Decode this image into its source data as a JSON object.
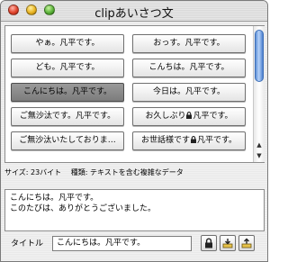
{
  "window": {
    "title": "clipあいさつ文"
  },
  "clips": [
    {
      "label": "やぁ。凡平です。",
      "locked": false,
      "selected": false
    },
    {
      "label": "おっす。凡平です。",
      "locked": false,
      "selected": false
    },
    {
      "label": "ども。凡平です。",
      "locked": false,
      "selected": false
    },
    {
      "label": "こんちは。凡平です。",
      "locked": false,
      "selected": false
    },
    {
      "label": "こんにちは。凡平です。",
      "locked": false,
      "selected": true
    },
    {
      "label": "今日は。凡平です。",
      "locked": false,
      "selected": false
    },
    {
      "label": "ご無沙汰です。凡平です。",
      "locked": false,
      "selected": false
    },
    {
      "label_before": "お久しぶり",
      "label_after": "凡平です。",
      "locked": true,
      "selected": false
    },
    {
      "label": "ご無沙汰いたしておりま…",
      "locked": false,
      "selected": false
    },
    {
      "label_before": "お世話様です",
      "label_after": "凡平です。",
      "locked": true,
      "selected": false
    }
  ],
  "info": {
    "size_label": "サイズ: 23バイト",
    "type_label": "種類: テキストを含む複雑なデータ"
  },
  "content": {
    "lines": [
      "こんにちは。凡平です。",
      "このたびは、ありがとうございました。"
    ]
  },
  "title_field": {
    "label": "タイトル",
    "value": "こんにちは。凡平です。"
  },
  "icons": {
    "lock_button": "lock-icon",
    "import_button": "import-icon",
    "export_button": "export-icon"
  }
}
